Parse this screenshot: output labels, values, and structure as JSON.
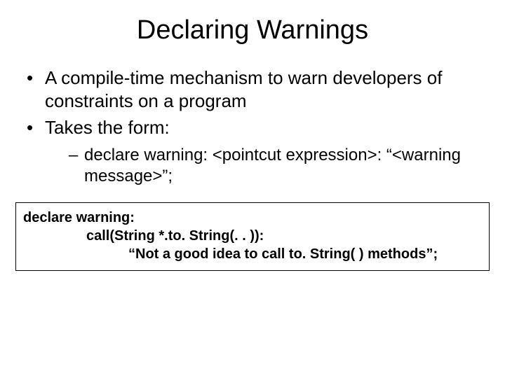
{
  "title": "Declaring Warnings",
  "bullets": {
    "b1": "A compile-time mechanism to warn developers of constraints on a program",
    "b2": "Takes the form:",
    "sub1": "declare warning: <pointcut expression>: “<warning message>”;"
  },
  "code": {
    "line1": "declare warning:",
    "line2": "call(String *.to. String(. . )):",
    "line3": "“Not a good idea to call to. String( ) methods”;"
  }
}
